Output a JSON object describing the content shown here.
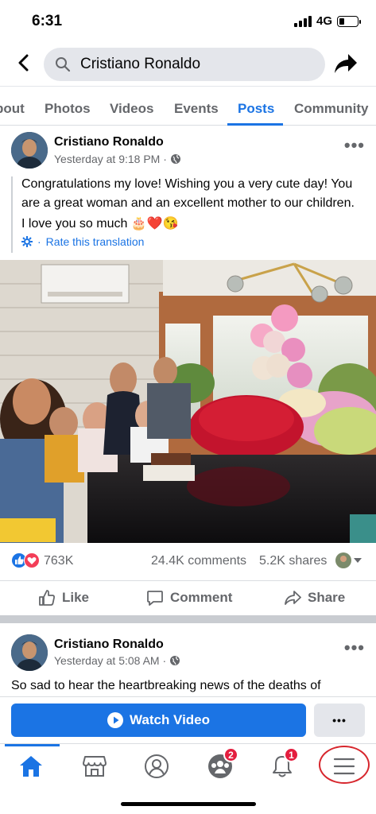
{
  "status_bar": {
    "time": "6:31",
    "network": "4G"
  },
  "search": {
    "query": "Cristiano Ronaldo"
  },
  "tabs": [
    {
      "label": "bout"
    },
    {
      "label": "Photos"
    },
    {
      "label": "Videos"
    },
    {
      "label": "Events"
    },
    {
      "label": "Posts"
    },
    {
      "label": "Community"
    }
  ],
  "active_tab": "Posts",
  "post1": {
    "author": "Cristiano Ronaldo",
    "timestamp": "Yesterday at 9:18 PM ·",
    "text_line1": "Congratulations my love! Wishing you a very cute day! You",
    "text_line2": "are a great woman and an excellent mother to our children.",
    "text_line3": "I love you so much 🎂❤️😘",
    "translation_link": "Rate this translation",
    "translation_prefix": "·",
    "reaction_count": "763K",
    "comments": "24.4K comments",
    "shares": "5.2K shares",
    "actions": {
      "like": "Like",
      "comment": "Comment",
      "share": "Share"
    }
  },
  "post2": {
    "author": "Cristiano Ronaldo",
    "timestamp": "Yesterday at 5:08 AM ·",
    "text": "So sad to hear the heartbreaking news of the deaths of"
  },
  "watch_video": {
    "label": "Watch Video",
    "more": "•••"
  },
  "more_menu_label": "•••",
  "bottom_nav": {
    "groups_badge": "2",
    "notifications_badge": "1"
  },
  "colors": {
    "accent": "#1b74e4",
    "badge": "#e41e3f",
    "highlight_circle": "#d7262d"
  }
}
